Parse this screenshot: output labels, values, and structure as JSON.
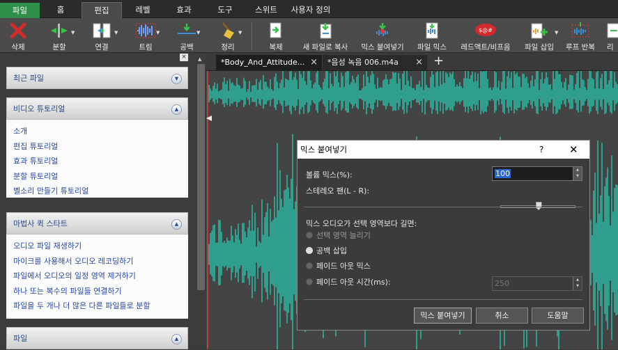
{
  "menubar": {
    "items": [
      {
        "label": "파일"
      },
      {
        "label": "홈"
      },
      {
        "label": "편집"
      },
      {
        "label": "레벨"
      },
      {
        "label": "효과"
      },
      {
        "label": "도구"
      },
      {
        "label": "스위트"
      },
      {
        "label": "사용자 정의"
      }
    ],
    "active_index": 2
  },
  "toolbar": {
    "items": [
      {
        "label": "삭제",
        "icon": "delete-x-icon"
      },
      {
        "label": "분할",
        "icon": "split-icon"
      },
      {
        "label": "연결",
        "icon": "join-icon"
      },
      {
        "label": "트림",
        "icon": "trim-icon"
      },
      {
        "label": "공백",
        "icon": "silence-icon"
      },
      {
        "label": "정리",
        "icon": "broom-icon"
      },
      {
        "label": "복제",
        "icon": "duplicate-icon"
      },
      {
        "label": "새 파일로 복사",
        "icon": "copy-to-new-icon"
      },
      {
        "label": "믹스 붙여넣기",
        "icon": "mix-paste-icon"
      },
      {
        "label": "파일 믹스",
        "icon": "mix-file-icon"
      },
      {
        "label": "레드액트/비프음",
        "icon": "beep-icon"
      },
      {
        "label": "파일 삽입",
        "icon": "insert-file-icon"
      },
      {
        "label": "루프 반복",
        "icon": "loop-icon"
      },
      {
        "label": "리",
        "icon": "reverse-icon"
      }
    ]
  },
  "sidebar": {
    "close_glyph": "×",
    "panels": [
      {
        "title": "최근 파일",
        "expanded": false,
        "links": []
      },
      {
        "title": "비디오 튜토리얼",
        "expanded": true,
        "links": [
          "소개",
          "편집 튜토리얼",
          "효과 튜토리얼",
          "분할 튜토리얼",
          "벨소리 만들기 튜토리얼"
        ]
      },
      {
        "title": "마법사 퀵 스타트",
        "expanded": true,
        "links": [
          "오디오 파일 재생하기",
          "마이크를 사용해서 오디오 레코딩하기",
          "파일에서 오디오의 일정 영역 제거하기",
          "하나 또는 복수의 파일들 연결하기",
          "파일을 두 개나 더 많은 다른 파일들로 분할"
        ]
      },
      {
        "title": "파일",
        "expanded": false,
        "links": []
      }
    ]
  },
  "tabs": [
    {
      "label": "*Body_And_Attitude...",
      "active": true
    },
    {
      "label": "*음성 녹음 006.m4a",
      "active": false
    }
  ],
  "new_tab_glyph": "+",
  "waveform": {
    "color": "#2ab59f",
    "background": "#444444"
  },
  "dialog": {
    "title": "믹스 붙여넣기",
    "help_glyph": "?",
    "close_glyph": "✕",
    "volume_label": "볼륨 믹스(%):",
    "volume_value": "100",
    "pan_label": "스테레오 팬(L - R):",
    "pan_value": 0,
    "section_label": "믹스 오디오가 선택 영역보다 길면:",
    "options": [
      {
        "label": "선택 영역 늘리기",
        "selected": false,
        "enabled": false
      },
      {
        "label": "공백 삽입",
        "selected": true,
        "enabled": true
      },
      {
        "label": "페이드 아웃 믹스",
        "selected": false,
        "enabled": true
      },
      {
        "label": "페이드 아웃 시간(ms):",
        "selected": false,
        "enabled": true
      }
    ],
    "fade_value": "250",
    "buttons": {
      "ok": "믹스 붙여넣기",
      "cancel": "취소",
      "help": "도움말"
    }
  }
}
